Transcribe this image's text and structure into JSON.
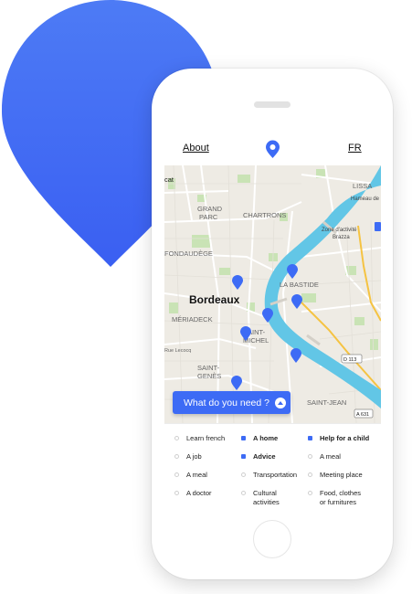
{
  "header": {
    "about_label": "About",
    "lang_label": "FR"
  },
  "map": {
    "labels": {
      "city": "Bordeaux",
      "chartrons": "CHARTRONS",
      "grand_parc_1": "GRAND",
      "grand_parc_2": "PARC",
      "fondaudege": "FONDAUDÈGE",
      "meriadeck": "MÉRIADECK",
      "la_bastide": "LA BASTIDE",
      "saint_michel_1": "SAINT-",
      "saint_michel_2": "MICHEL",
      "saint_genes_1": "SAINT-",
      "saint_genes_2": "GENÈS",
      "saint_jean": "SAINT-JEAN",
      "zone_1": "Zone d'activité",
      "zone_2": "Brazza",
      "lissa": "LISSA",
      "hameau": "Hameau de",
      "cat": "cat",
      "rue_lecocq": "Rue Lecocq",
      "d113": "D 113",
      "a631": "A 631"
    },
    "colors": {
      "river": "#62c6e6",
      "land": "#eeebe4",
      "park": "#c9e3b5",
      "pin": "#3d6bf5",
      "highway": "#f5c342"
    }
  },
  "cta": {
    "label": "What do you need ?"
  },
  "filters": {
    "col1": [
      "Learn french",
      "A job",
      "A meal",
      "A doctor"
    ],
    "col2": [
      "A home",
      "Advice",
      "Transportation",
      "Cultural",
      "activities"
    ],
    "col3": [
      "Help for a child",
      "A meal",
      "Meeting place",
      "Food, clothes",
      "or furnitures"
    ],
    "selected": [
      "A home",
      "Advice",
      "Help for a child"
    ]
  }
}
